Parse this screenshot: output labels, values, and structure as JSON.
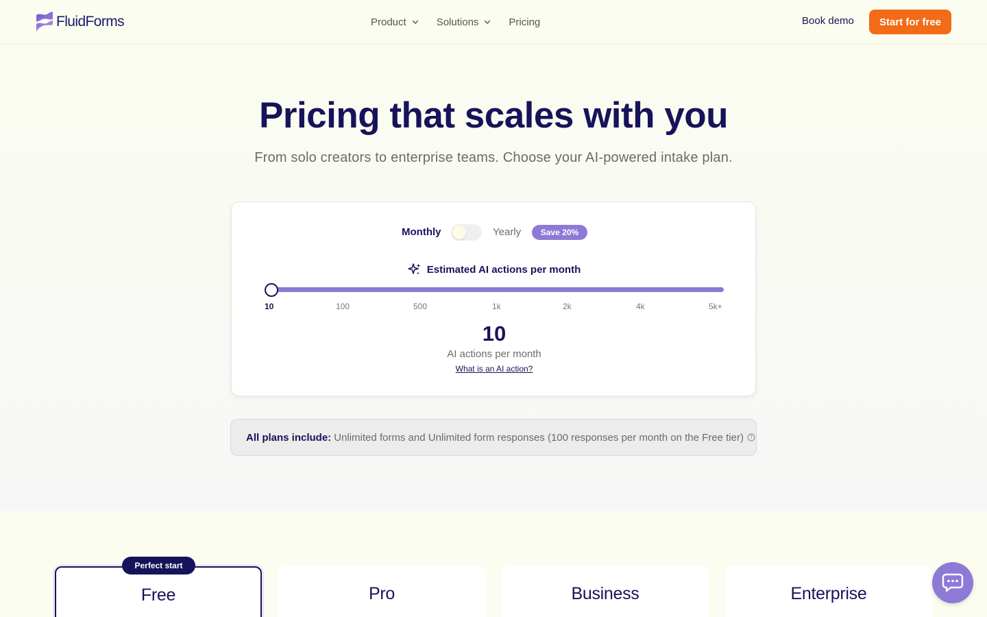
{
  "nav": {
    "brand": "FluidForms",
    "links": [
      {
        "label": "Product",
        "has_dropdown": true
      },
      {
        "label": "Solutions",
        "has_dropdown": true
      },
      {
        "label": "Pricing",
        "has_dropdown": false
      }
    ],
    "book_demo": "Book demo",
    "start_free": "Start for free"
  },
  "hero": {
    "title": "Pricing that scales with you",
    "subtitle": "From solo creators to enterprise teams. Choose your AI-powered intake plan."
  },
  "estimator": {
    "monthly_label": "Monthly",
    "yearly_label": "Yearly",
    "save_badge": "Save 20%",
    "billing_yearly_enabled": false,
    "heading": "Estimated AI actions per month",
    "ticks": [
      "10",
      "100",
      "500",
      "1k",
      "2k",
      "4k",
      "5k+"
    ],
    "selected_tick_index": 0,
    "value": "10",
    "value_label": "AI actions per month",
    "help_link": "What is an AI action?"
  },
  "includes": {
    "label": "All plans include:",
    "text": "Unlimited forms and Unlimited form responses (100 responses per month on the Free tier)"
  },
  "plans": [
    {
      "name": "Free",
      "badge": "Perfect start",
      "featured": true
    },
    {
      "name": "Pro",
      "featured": false
    },
    {
      "name": "Business",
      "featured": false
    },
    {
      "name": "Enterprise",
      "featured": false
    }
  ],
  "colors": {
    "accent_orange": "#f26b16",
    "accent_purple": "#8e7ad6",
    "navy": "#17135a"
  },
  "icons": {
    "logo": "fluidforms-logo-icon",
    "chevron": "chevron-down-icon",
    "sparkle": "sparkle-icon",
    "info": "info-icon",
    "chat": "chat-icon"
  }
}
